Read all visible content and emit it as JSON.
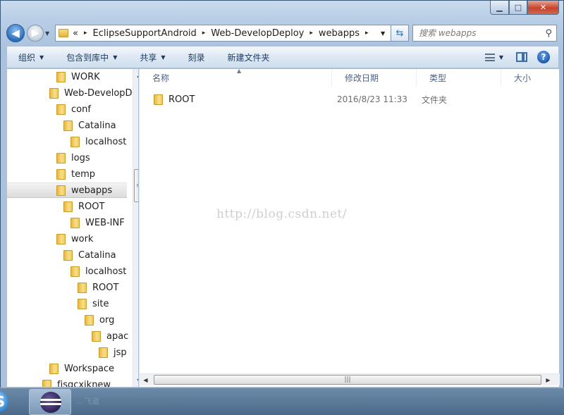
{
  "window": {
    "controls": {
      "minimize": "▁",
      "maximize": "□",
      "close": "✕"
    }
  },
  "address": {
    "overflow": "«",
    "crumbs": [
      "EclipseSupportAndroid",
      "Web-DevelopDeploy",
      "webapps"
    ],
    "separator": "▸"
  },
  "search": {
    "placeholder": "搜索 webapps"
  },
  "toolbar": {
    "organize": "组织",
    "include_in_library": "包含到库中",
    "share": "共享",
    "burn": "刻录",
    "new_folder": "新建文件夹"
  },
  "nav_tree": [
    {
      "label": "WORK",
      "indent": 70
    },
    {
      "label": "Web-DevelopD",
      "indent": 60
    },
    {
      "label": "conf",
      "indent": 70
    },
    {
      "label": "Catalina",
      "indent": 80
    },
    {
      "label": "localhost",
      "indent": 90
    },
    {
      "label": "logs",
      "indent": 70
    },
    {
      "label": "temp",
      "indent": 70
    },
    {
      "label": "webapps",
      "indent": 70,
      "selected": true
    },
    {
      "label": "ROOT",
      "indent": 80
    },
    {
      "label": "WEB-INF",
      "indent": 90
    },
    {
      "label": "work",
      "indent": 70
    },
    {
      "label": "Catalina",
      "indent": 80
    },
    {
      "label": "localhost",
      "indent": 90
    },
    {
      "label": "ROOT",
      "indent": 100
    },
    {
      "label": "site",
      "indent": 100
    },
    {
      "label": "org",
      "indent": 110
    },
    {
      "label": "apac",
      "indent": 120
    },
    {
      "label": "jsp",
      "indent": 130
    },
    {
      "label": "Workspace",
      "indent": 60
    },
    {
      "label": "fjsqcxjknew",
      "indent": 50
    }
  ],
  "columns": {
    "name": "名称",
    "modified": "修改日期",
    "type": "类型",
    "size": "大小"
  },
  "files": [
    {
      "name": "ROOT",
      "modified": "2016/8/23 11:33",
      "type": "文件夹",
      "size": ""
    }
  ],
  "watermark": "http://blog.csdn.net/",
  "scroll_grip": "≡",
  "h_scroll_grip": "|||",
  "taskbar": {
    "faint_text": "…飞道"
  },
  "colors": {
    "window_frame": "#b7cde5",
    "toolbar": "#dde8f4",
    "selection": "#dcdcdc"
  }
}
